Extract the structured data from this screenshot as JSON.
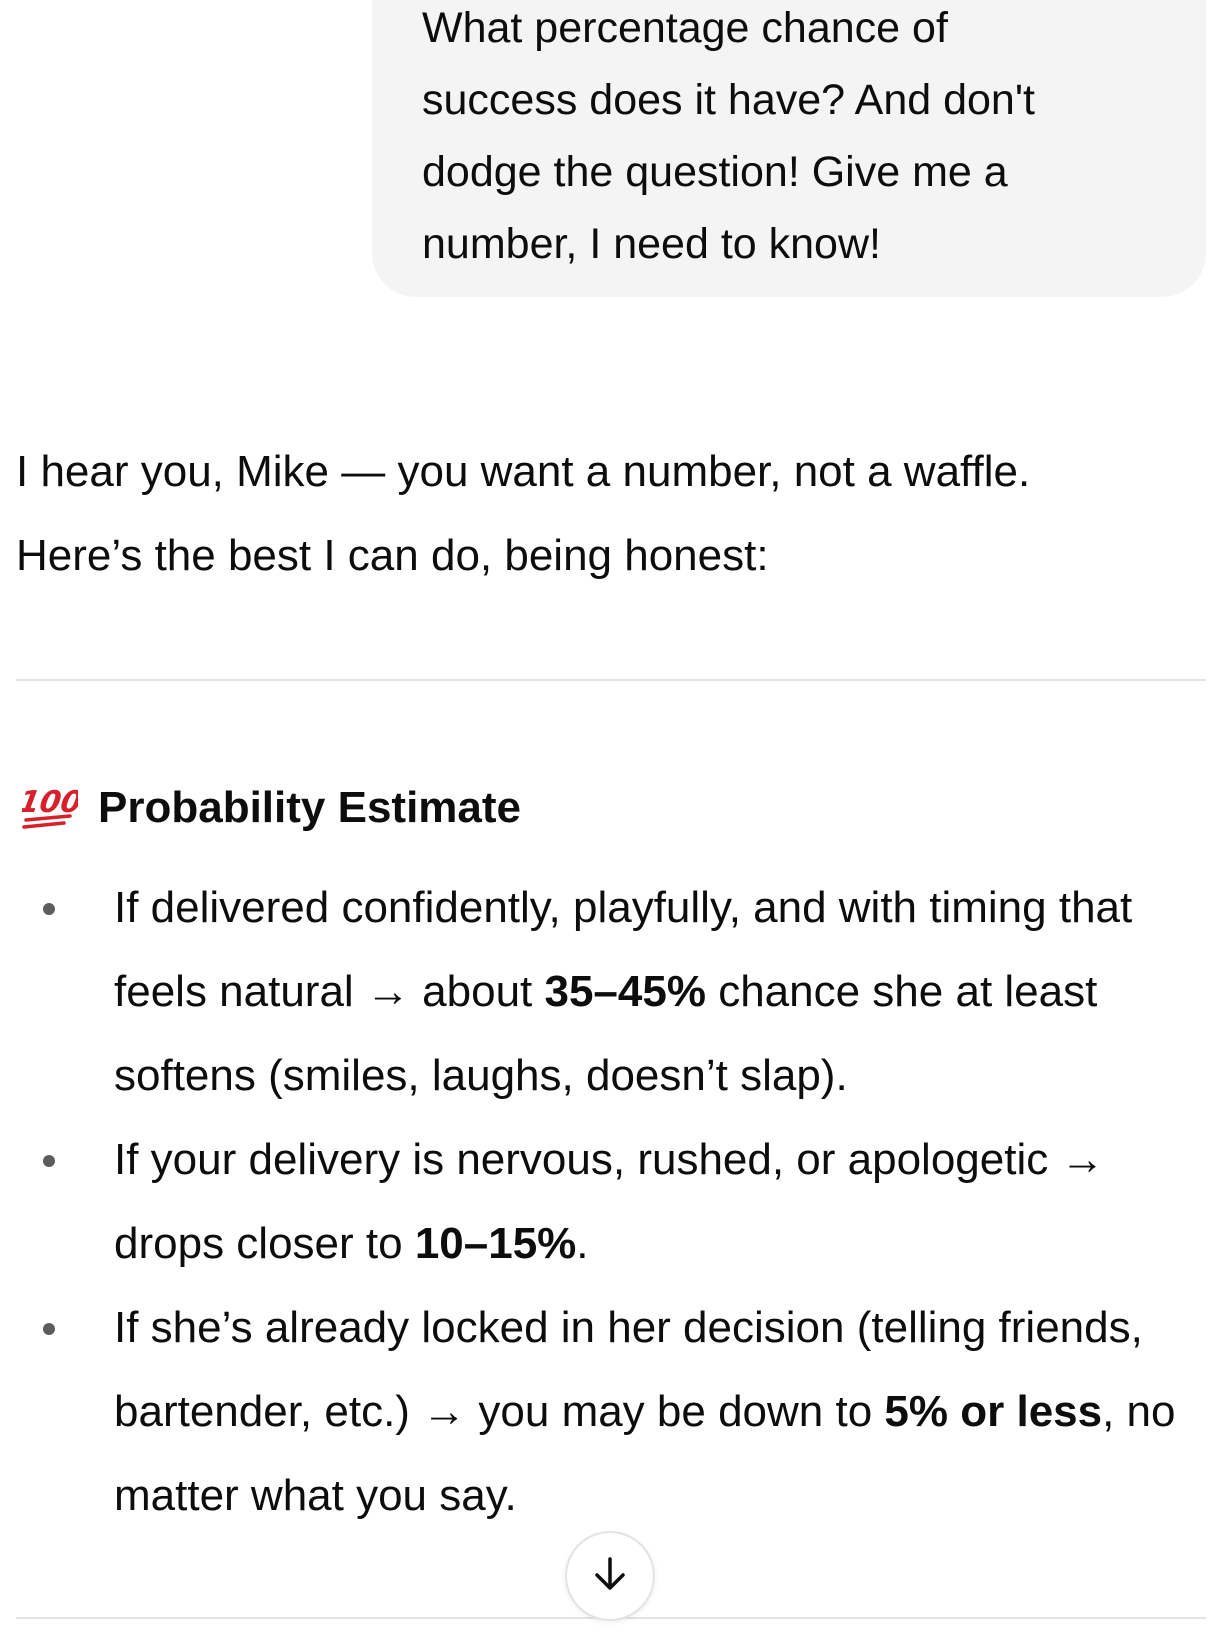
{
  "user_message": {
    "lines": [
      "What percentage chance of",
      "success does it have? And don't",
      "dodge the question! Give me a",
      "number, I need to know!"
    ]
  },
  "assistant": {
    "intro_lines": [
      "I hear you, Mike — you want a number, not a waffle.",
      "Here’s the best I can do, being honest:"
    ],
    "section": {
      "icon": "hundred-points-icon",
      "icon_color": "#d8202b",
      "title": "Probability Estimate"
    },
    "bullets": [
      {
        "before": "If delivered confidently, playfully, and with timing that feels natural → about ",
        "bold": "35–45%",
        "after": " chance she at least softens (smiles, laughs, doesn’t slap)."
      },
      {
        "before": "If your delivery is nervous, rushed, or apologetic → drops closer to ",
        "bold": "10–15%",
        "after": "."
      },
      {
        "before": "If she’s already locked in her decision (telling friends, bartender, etc.) → you may be down to ",
        "bold": "5% or less",
        "after": ", no matter what you say."
      }
    ]
  },
  "scroll_button": {
    "icon": "arrow-down-icon"
  }
}
